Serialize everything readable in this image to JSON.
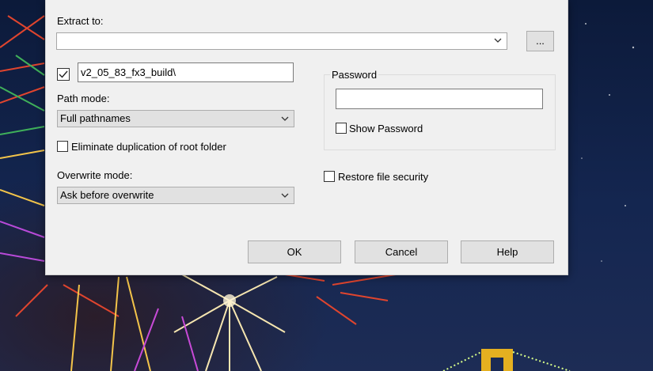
{
  "background": {
    "name": "fireworks-wallpaper"
  },
  "dialog": {
    "extract_to": {
      "label": "Extract to:",
      "value": "",
      "browse_label": "..."
    },
    "subfolder": {
      "checked": true,
      "value": "v2_05_83_fx3_build\\"
    },
    "path_mode": {
      "label": "Path mode:",
      "selected": "Full pathnames"
    },
    "eliminate_duplication": {
      "label": "Eliminate duplication of root folder",
      "checked": false
    },
    "overwrite_mode": {
      "label": "Overwrite mode:",
      "selected": "Ask before overwrite"
    },
    "password": {
      "group_label": "Password",
      "value": "",
      "show_password_label": "Show Password",
      "show_password_checked": false
    },
    "restore_security": {
      "label": "Restore file security",
      "checked": false
    },
    "buttons": {
      "ok": "OK",
      "cancel": "Cancel",
      "help": "Help"
    }
  },
  "colors": {
    "dialog_bg": "#f0f0f0",
    "button_bg": "#e1e1e1",
    "sky": "#0c1a3a"
  }
}
